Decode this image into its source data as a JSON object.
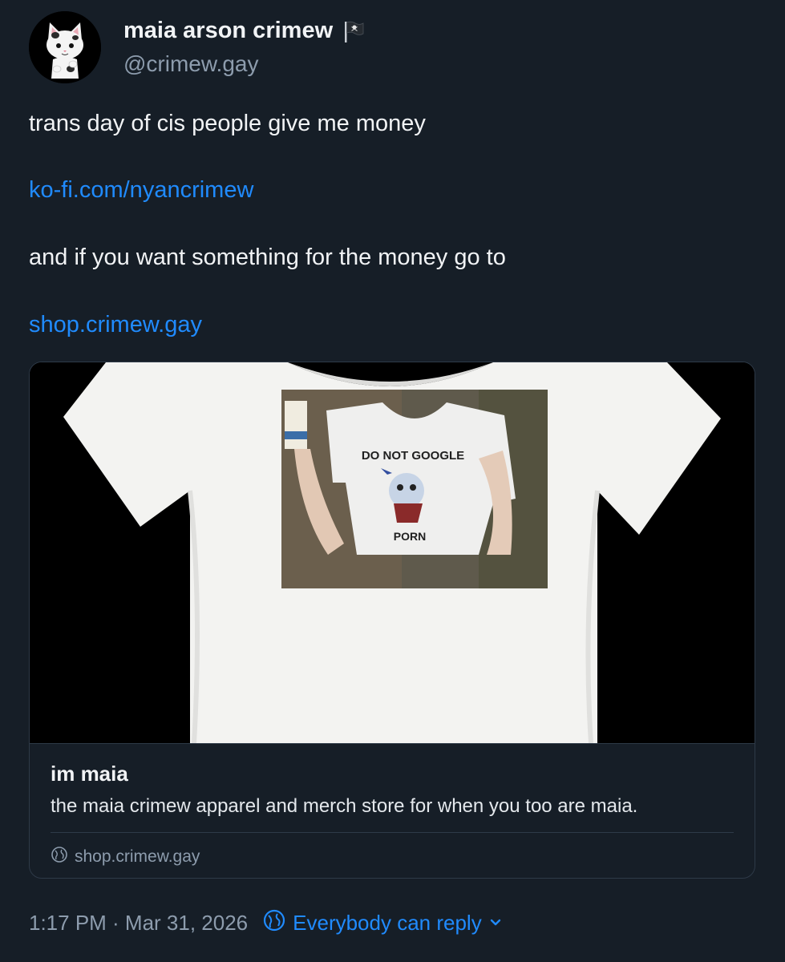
{
  "author": {
    "display_name": "maia arson crimew",
    "handle": "@crimew.gay",
    "flag_icon": "pirate-flag-icon"
  },
  "post": {
    "line1": "trans day of cis people give me money",
    "link1": "ko-fi.com/nyancrimew",
    "line2": "and if you want something for the money go to",
    "link2": "shop.crimew.gay"
  },
  "embed": {
    "image_text_top": "DO NOT GOOGLE",
    "image_text_bottom": "PORN",
    "title": "im maia",
    "description": "the maia crimew apparel and merch store for when you too are maia.",
    "domain": "shop.crimew.gay"
  },
  "footer": {
    "timestamp": "1:17 PM · Mar 31, 2026",
    "reply_setting": "Everybody can reply"
  },
  "colors": {
    "background": "#161e27",
    "link": "#208bfe",
    "muted": "#8d9cad",
    "text": "#f1f3f5"
  }
}
